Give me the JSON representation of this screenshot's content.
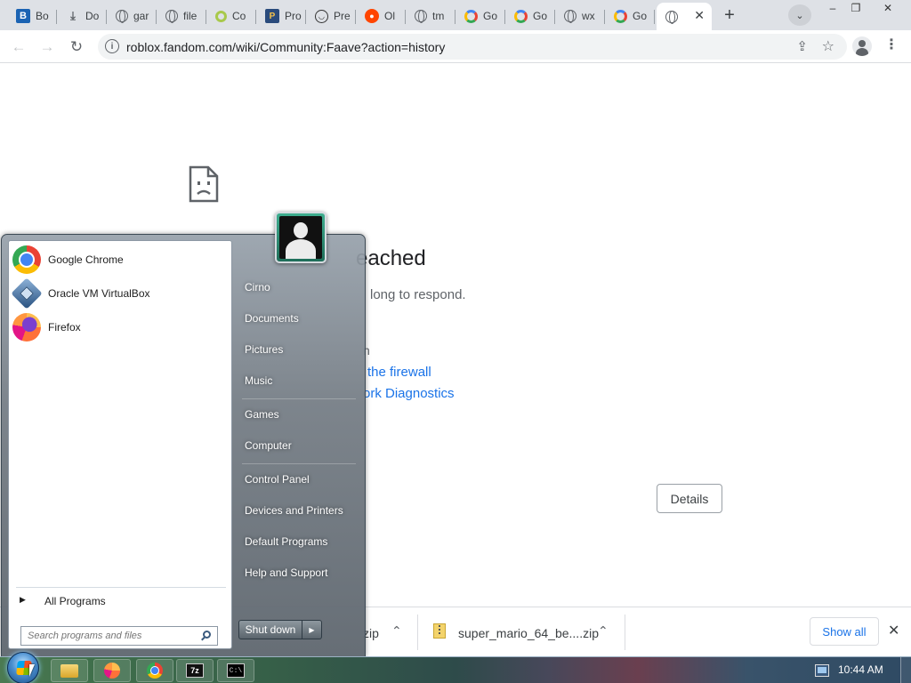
{
  "browser": {
    "tabs": [
      {
        "title": "Bo",
        "icon": "bold-b-icon"
      },
      {
        "title": "Do",
        "icon": "download-icon"
      },
      {
        "title": "gar",
        "icon": "globe-icon"
      },
      {
        "title": "file",
        "icon": "globe-icon"
      },
      {
        "title": "Co",
        "icon": "circle-o-icon"
      },
      {
        "title": "Pro",
        "icon": "p-icon"
      },
      {
        "title": "Pre",
        "icon": "smiley-icon"
      },
      {
        "title": "Ol",
        "icon": "reddit-icon"
      },
      {
        "title": "tm",
        "icon": "globe-icon"
      },
      {
        "title": "Go",
        "icon": "google-icon"
      },
      {
        "title": "Go",
        "icon": "google-icon"
      },
      {
        "title": "wx",
        "icon": "globe-icon"
      },
      {
        "title": "Go",
        "icon": "google-icon"
      },
      {
        "title": "",
        "icon": "globe-icon",
        "active": true
      }
    ],
    "close_glyph": "✕",
    "new_tab_glyph": "+",
    "tab_search_glyph": "⌄",
    "window_minimize": "–",
    "window_restore": "❐",
    "window_close": "✕",
    "nav": {
      "back": "←",
      "forward": "→",
      "reload": "↻"
    },
    "address": {
      "url": "roblox.fandom.com/wiki/Community:Faave?action=history",
      "info_glyph": "i"
    },
    "share_glyph": "⇪",
    "bookmark_glyph": "☆",
    "menu_glyph": "⋮"
  },
  "error_page": {
    "heading_fragment": "eached",
    "description_fragment": "long to respond.",
    "try_fragment": "n",
    "link_firewall_fragment": "the firewall",
    "link_diagnostics_fragment": "ork Diagnostics",
    "details_label": "Details"
  },
  "downloads": {
    "item1_fragment": "zip",
    "item2_name": "super_mario_64_be....zip",
    "caret_glyph": "⌃",
    "show_all_label": "Show all",
    "close_glyph": "✕"
  },
  "start_menu": {
    "pinned": [
      {
        "label": "Google Chrome",
        "icon": "chrome-icon"
      },
      {
        "label": "Oracle VM VirtualBox",
        "icon": "virtualbox-icon"
      },
      {
        "label": "Firefox",
        "icon": "firefox-icon"
      }
    ],
    "all_programs_label": "All Programs",
    "all_programs_arrow": "▶",
    "search_placeholder": "Search programs and files",
    "right_items": [
      "Cirno",
      "Documents",
      "Pictures",
      "Music",
      "Games",
      "Computer",
      "Control Panel",
      "Devices and Printers",
      "Default Programs",
      "Help and Support"
    ],
    "shutdown_label": "Shut down",
    "shutdown_arrow": "▶"
  },
  "taskbar": {
    "tasks": [
      "explorer-icon",
      "firefox-icon",
      "chrome-icon",
      "7zip-icon",
      "cmd-icon"
    ],
    "sevenzip_text": "7z",
    "cmd_text": "C:\\",
    "clock": "10:44 AM"
  }
}
